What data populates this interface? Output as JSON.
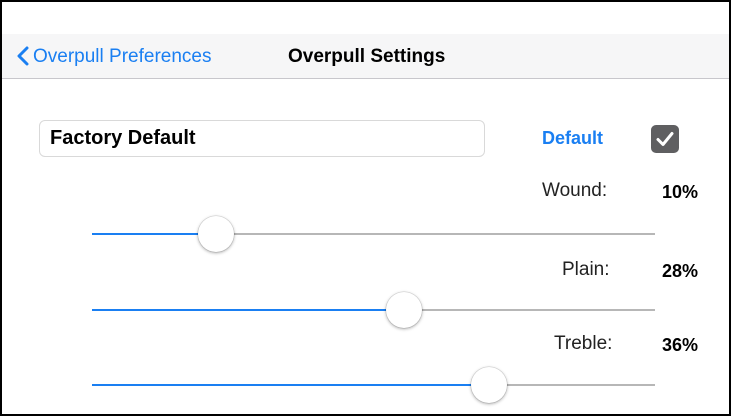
{
  "nav": {
    "back_label": "Overpull Preferences",
    "title": "Overpull Settings"
  },
  "preset": {
    "name_value": "Factory Default",
    "default_label": "Default",
    "default_checked": true
  },
  "params": [
    {
      "label": "Wound:",
      "value_text": "10%",
      "slider_fraction": 0.22
    },
    {
      "label": "Plain:",
      "value_text": "28%",
      "slider_fraction": 0.555
    },
    {
      "label": "Treble:",
      "value_text": "36%",
      "slider_fraction": 0.706
    }
  ],
  "colors": {
    "accent": "#1a7ff2",
    "track": "#b7b7b7",
    "checkbox": "#5f5f61"
  },
  "icons": {
    "back": "chevron-left-icon",
    "check": "checkmark-icon"
  }
}
